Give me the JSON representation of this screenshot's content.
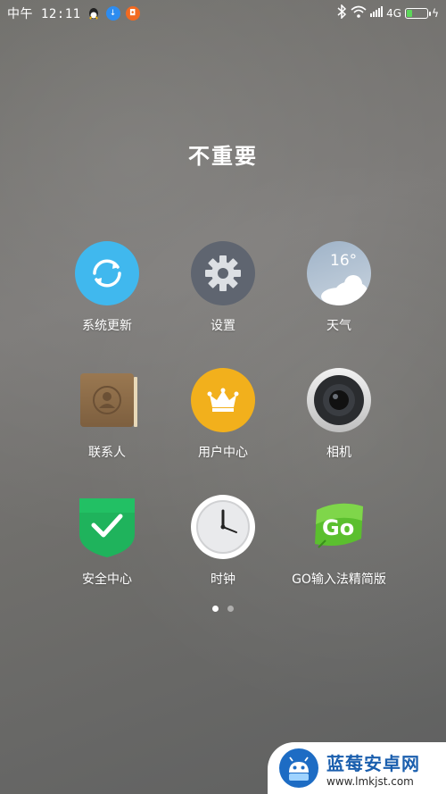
{
  "status_bar": {
    "carrier_time": "中午 12:11",
    "network": "4G",
    "battery_level": 0.3
  },
  "folder": {
    "title": "不重要",
    "apps": [
      {
        "label": "系统更新",
        "icon": "refresh-icon",
        "color": "#40b8ee"
      },
      {
        "label": "设置",
        "icon": "gear-icon",
        "color": "#5f6570"
      },
      {
        "label": "天气",
        "icon": "weather-cloud-icon",
        "color": "#b7c6d6",
        "temp": "16°"
      },
      {
        "label": "联系人",
        "icon": "contacts-book-icon",
        "color": "#8e6e4c"
      },
      {
        "label": "用户中心",
        "icon": "crown-icon",
        "color": "#f2b01c"
      },
      {
        "label": "相机",
        "icon": "camera-lens-icon",
        "color": "#d9d9d9"
      },
      {
        "label": "安全中心",
        "icon": "shield-check-icon",
        "color": "#1fb35c"
      },
      {
        "label": "时钟",
        "icon": "clock-icon",
        "color": "#e8e8e8"
      },
      {
        "label": "GO输入法精简版",
        "icon": "go-keyboard-icon",
        "color": "#5bbf2e"
      }
    ]
  },
  "pager": {
    "pages": 2,
    "active": 1
  },
  "watermark": {
    "name": "蓝莓安卓网",
    "url": "www.lmkjst.com"
  }
}
